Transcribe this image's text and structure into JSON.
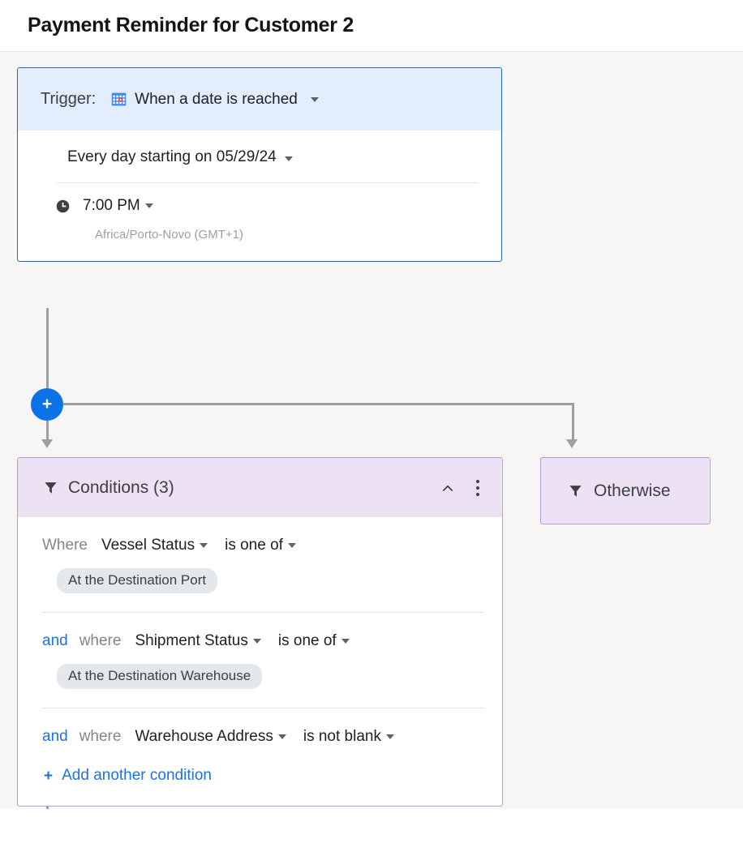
{
  "header": {
    "title": "Payment Reminder for Customer 2"
  },
  "trigger": {
    "label": "Trigger:",
    "icon": "calendar-icon",
    "type_value": "When a date is reached",
    "schedule_value": "Every day starting on 05/29/24",
    "time_icon": "clock-icon",
    "time_value": "7:00 PM",
    "timezone": "Africa/Porto-Novo (GMT+1)"
  },
  "add_step": {
    "icon": "plus-icon",
    "label": "+"
  },
  "conditions": {
    "icon": "funnel-icon",
    "title": "Conditions (3)",
    "collapse_icon": "chevron-up-icon",
    "menu_icon": "kebab-menu-icon",
    "rows": [
      {
        "conjunction": "",
        "where": "Where",
        "field": "Vessel Status",
        "operator": "is one of",
        "chip": "At the Destination Port"
      },
      {
        "conjunction": "and",
        "where": "where",
        "field": "Shipment Status",
        "operator": "is one of",
        "chip": "At the Destination Warehouse"
      },
      {
        "conjunction": "and",
        "where": "where",
        "field": "Warehouse Address",
        "operator": "is not blank",
        "chip": ""
      }
    ],
    "add_label": "Add another condition",
    "add_icon": "plus-icon"
  },
  "otherwise": {
    "icon": "funnel-icon",
    "label": "Otherwise"
  },
  "colors": {
    "accent_blue": "#0b72e7",
    "link_blue": "#1a73e8",
    "trigger_header_bg": "#e3eefc",
    "trigger_border": "#1967d2",
    "condition_header_bg": "#ece2f4",
    "condition_border": "#b39ddb",
    "chip_bg": "#e4e8ec",
    "canvas_bg": "#f7f6f4",
    "connector": "#9aa0a6"
  }
}
